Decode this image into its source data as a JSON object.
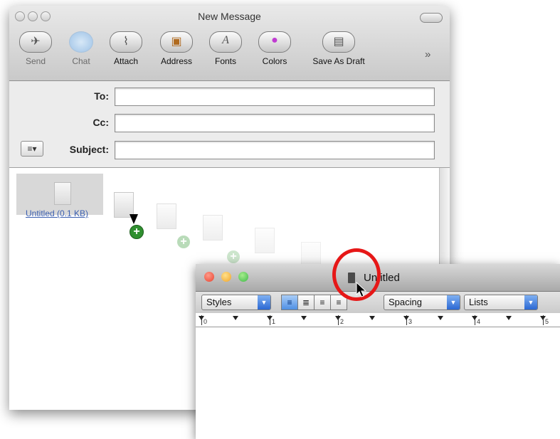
{
  "mail": {
    "title": "New Message",
    "toolbar": [
      {
        "id": "send",
        "label": "Send",
        "icon": "send-icon",
        "enabled": false,
        "glyph": "✈"
      },
      {
        "id": "chat",
        "label": "Chat",
        "icon": "chat-bubble-icon",
        "enabled": false,
        "glyph": ""
      },
      {
        "id": "attach",
        "label": "Attach",
        "icon": "paperclip-icon",
        "enabled": true,
        "glyph": "⌇"
      },
      {
        "id": "address",
        "label": "Address",
        "icon": "address-book-icon",
        "enabled": true,
        "glyph": "▣"
      },
      {
        "id": "fonts",
        "label": "Fonts",
        "icon": "fonts-icon",
        "enabled": true,
        "glyph": "A"
      },
      {
        "id": "colors",
        "label": "Colors",
        "icon": "color-wheel-icon",
        "enabled": true,
        "glyph": "●"
      },
      {
        "id": "draft",
        "label": "Save As Draft",
        "icon": "save-draft-icon",
        "enabled": true,
        "glyph": "▤"
      }
    ],
    "overflow": "»",
    "fields": {
      "to_label": "To:",
      "cc_label": "Cc:",
      "subject_label": "Subject:",
      "to_value": "",
      "cc_value": "",
      "subject_value": ""
    },
    "header_menu_glyph": "≡▾",
    "attachment": {
      "name": "Untitled (0.1 KB)"
    }
  },
  "textedit": {
    "title": "Untitled",
    "styles": "Styles",
    "spacing": "Spacing",
    "lists": "Lists",
    "align": [
      "≡",
      "≣",
      "≡",
      "≡"
    ],
    "ruler_numbers": [
      "0",
      "1",
      "2",
      "3",
      "4",
      "5"
    ]
  },
  "colors": {
    "close": "#e8422f",
    "minimize": "#f0b12a",
    "zoom": "#3fb94a",
    "highlight": "#e61717",
    "plus": "#2f8f2f"
  }
}
